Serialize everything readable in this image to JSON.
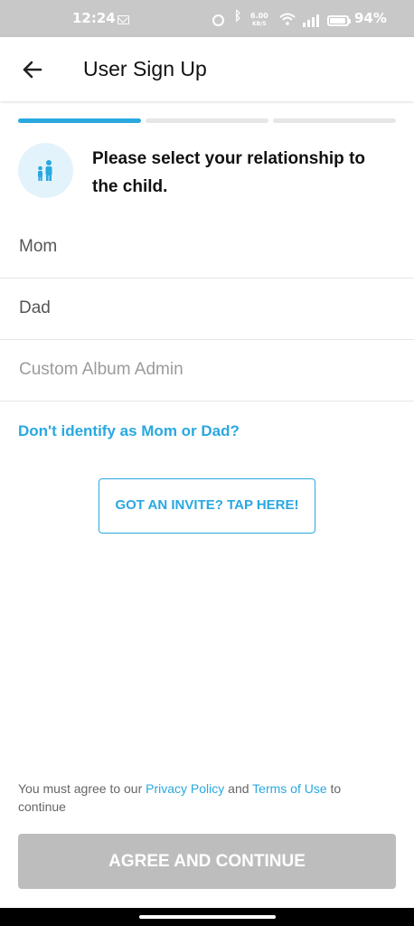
{
  "status_bar": {
    "time": "12:24",
    "network_speed": "6.00",
    "network_speed_unit": "KB/S",
    "battery_percent": "94%",
    "battery_level": 0.94,
    "icons": [
      "mail-icon",
      "alarm-icon",
      "bluetooth-icon",
      "wifi-icon",
      "signal-icon",
      "battery-icon"
    ]
  },
  "header": {
    "back_icon": "arrow-left-icon",
    "title": "User Sign Up"
  },
  "progress": {
    "total_steps": 3,
    "current_step": 1,
    "active_color": "#29a8e0",
    "inactive_color": "#e6e6e6"
  },
  "prompt": {
    "icon": "parent-child-icon",
    "text": "Please select your relationship to the child."
  },
  "options": [
    {
      "label": "Mom"
    },
    {
      "label": "Dad"
    },
    {
      "label": "Custom Album Admin"
    }
  ],
  "identify_link": "Don't identify as Mom or Dad?",
  "invite_button": "GOT AN INVITE? TAP HERE!",
  "terms": {
    "prefix": "You must agree to our ",
    "privacy_link": "Privacy Policy",
    "middle": " and ",
    "terms_link": "Terms of Use",
    "suffix": " to continue"
  },
  "continue_button": "AGREE AND CONTINUE",
  "colors": {
    "accent": "#29a8e0",
    "disabled_button": "#bdbdbd",
    "status_bar": "#c8c8c8"
  }
}
